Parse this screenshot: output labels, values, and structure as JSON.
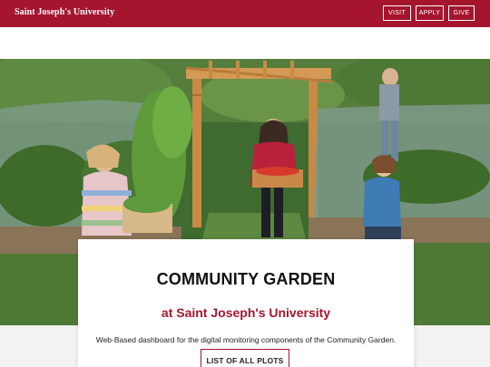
{
  "header": {
    "brand": "Saint Joseph's University",
    "nav": [
      "VISIT",
      "APPLY",
      "GIVE"
    ]
  },
  "colors": {
    "brand_red": "#a5152e",
    "background": "#f2f2f2",
    "card": "#ffffff"
  },
  "hero": {
    "image": "community-garden-photo"
  },
  "card": {
    "title": "COMMUNITY GARDEN",
    "subtitle": "at Saint Joseph's University",
    "description": "Web-Based dashboard for the digital monitoring components of the Community Garden.",
    "button_label": "LIST OF ALL PLOTS"
  }
}
